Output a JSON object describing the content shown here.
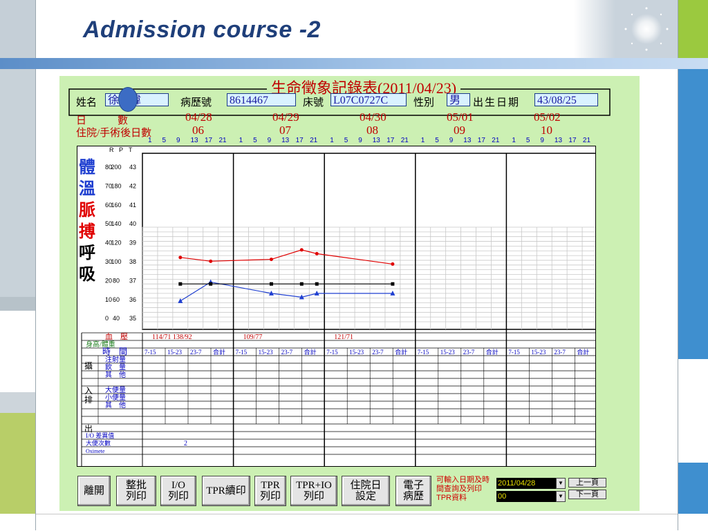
{
  "slide": {
    "title": "Admission course -2"
  },
  "form": {
    "title": "生命徵象記錄表(2011/04/23)",
    "name_label": "姓名",
    "name_value": "徐　緯",
    "chart_no_label": "病歷號",
    "chart_no": "8614467",
    "bed_label": "床號",
    "bed_no": "L07C0727C",
    "sex_label": "性別",
    "sex": "男",
    "dob_label": "出生日期",
    "dob": "43/08/25",
    "date_row_label": "日　　　數",
    "day_row_label": "住院/手術後日數",
    "dates": [
      "04/28",
      "04/29",
      "04/30",
      "05/01",
      "05/02"
    ],
    "day_counts": [
      "06",
      "07",
      "08",
      "09",
      "10"
    ],
    "hours": [
      "1",
      "5",
      "9",
      "13",
      "17",
      "21"
    ]
  },
  "vitals_chart": {
    "axis_header": [
      "R",
      "P",
      "T"
    ],
    "vertical_labels": [
      "體",
      "溫",
      "脈",
      "搏",
      "呼",
      "吸"
    ],
    "scale_rows": [
      {
        "r": "80",
        "p": "200",
        "t": "43"
      },
      {
        "r": "70",
        "p": "180",
        "t": "42"
      },
      {
        "r": "60",
        "p": "160",
        "t": "41"
      },
      {
        "r": "50",
        "p": "140",
        "t": "40"
      },
      {
        "r": "40",
        "p": "120",
        "t": "39"
      },
      {
        "r": "30",
        "p": "100",
        "t": "38"
      },
      {
        "r": "20",
        "p": "80",
        "t": "37"
      },
      {
        "r": "10",
        "p": "60",
        "t": "36"
      },
      {
        "r": "0",
        "p": "40",
        "t": "35"
      }
    ],
    "colors": {
      "pulse": "#e00000",
      "temp": "#1f3fd0",
      "resp": "#000000",
      "grid": "#c8c8c8"
    }
  },
  "chart_data": {
    "type": "line",
    "x_unit": "hour slot (day 04/28 slot 1 = 1)",
    "series": [
      {
        "name": "脈搏",
        "values": [
          [
            3,
            108
          ],
          [
            5,
            104
          ],
          [
            9,
            106
          ],
          [
            11,
            116
          ],
          [
            12,
            112
          ],
          [
            17,
            101
          ]
        ]
      },
      {
        "name": "體溫",
        "values": [
          [
            3,
            36.1
          ],
          [
            5,
            37.1
          ],
          [
            9,
            36.5
          ],
          [
            11,
            36.3
          ],
          [
            12,
            36.5
          ],
          [
            17,
            36.5
          ]
        ]
      },
      {
        "name": "呼吸",
        "values": [
          [
            3,
            20
          ],
          [
            5,
            20
          ],
          [
            9,
            20
          ],
          [
            11,
            20
          ],
          [
            12,
            20
          ],
          [
            17,
            20
          ]
        ]
      }
    ]
  },
  "table": {
    "bp_label": "血　壓",
    "bp_values": [
      "114/71 138/92",
      "109/77",
      "121/71",
      "",
      ""
    ],
    "height_weight_label": "身高/體重",
    "time_label": "時　間",
    "shift_labels": [
      "7-15",
      "15-23",
      "23-7",
      "合計"
    ],
    "intake_group": "攝　入",
    "intake_rows": [
      "注射量",
      "飲　量",
      "其　他"
    ],
    "output_group": "排　出",
    "output_rows": [
      "大便量",
      "小便量",
      "其　他"
    ],
    "io_diff_label": "I/O 差異值",
    "stool_label": "大便次數",
    "stool_value": "2",
    "oximeter_label": "Oximete"
  },
  "buttons": {
    "leave": "離開",
    "batch_print": [
      "整批",
      "列印"
    ],
    "io_print": [
      "I/O",
      "列印"
    ],
    "tpr_continue": "TPR續印",
    "tpr_print": [
      "TPR",
      "列印"
    ],
    "tpr_io_print": [
      "TPR+IO",
      "列印"
    ],
    "admission_date_set": [
      "住院日",
      "設定"
    ],
    "emr": [
      "電子",
      "病歷"
    ]
  },
  "query": {
    "hint": "可輸入日期及時間查詢及列印TPR資料",
    "date_value": "2011/04/28",
    "time_value": "00",
    "prev_page": "上一頁",
    "next_page": "下一頁"
  }
}
